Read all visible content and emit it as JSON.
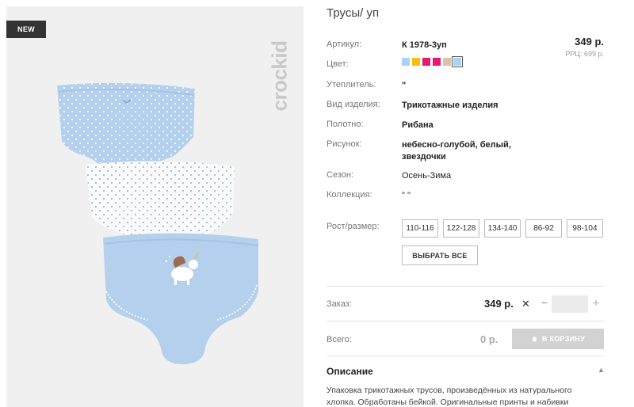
{
  "image": {
    "badge": "NEW",
    "brand_logo": "crockid"
  },
  "product": {
    "title": "Трусы/ уп",
    "price": "349 р.",
    "rrp": "РРЦ: 699 р."
  },
  "attributes": {
    "article_label": "Артикул:",
    "article_value": "К 1978-3уп",
    "color_label": "Цвет:",
    "colors": [
      "#a9d3f2",
      "#f4c20d",
      "#e8196c",
      "#e8196c",
      "#d9c3a8",
      "#a9d3f2"
    ],
    "selected_color_index": 5,
    "insulation_label": "Утеплитель:",
    "insulation_value": "\"",
    "type_label": "Вид изделия:",
    "type_value": "Трикотажные изделия",
    "fabric_label": "Полотно:",
    "fabric_value": "Рибана",
    "pattern_label": "Рисунок:",
    "pattern_value": "небесно-голубой, белый, звездочки",
    "season_label": "Сезон:",
    "season_value": "Осень-Зима",
    "collection_label": "Коллекция:",
    "collection_value": "\" \""
  },
  "sizes": {
    "label": "Рост/размер:",
    "options": [
      "110-116",
      "122-128",
      "134-140",
      "86-92",
      "98-104"
    ],
    "select_all": "ВЫБРАТЬ ВСЕ"
  },
  "order": {
    "label": "Заказ:",
    "price": "349 р.",
    "remove_icon": "close-icon",
    "minus": "−",
    "plus": "+",
    "quantity": ""
  },
  "total": {
    "label": "Всего:",
    "value": "0 р.",
    "cart_button": "В КОРЗИНУ",
    "cart_icon": "cart-icon"
  },
  "description": {
    "title": "Описание",
    "text": "Упаковка трикотажных трусов, произведённых из натурального хлопка. Обработаны бейкой. Оригинальные принты и набивки"
  },
  "colors": {
    "accent_dark": "#333333",
    "button_disabled": "#d2d2d2",
    "garment_blue": "#b5d0ec"
  }
}
